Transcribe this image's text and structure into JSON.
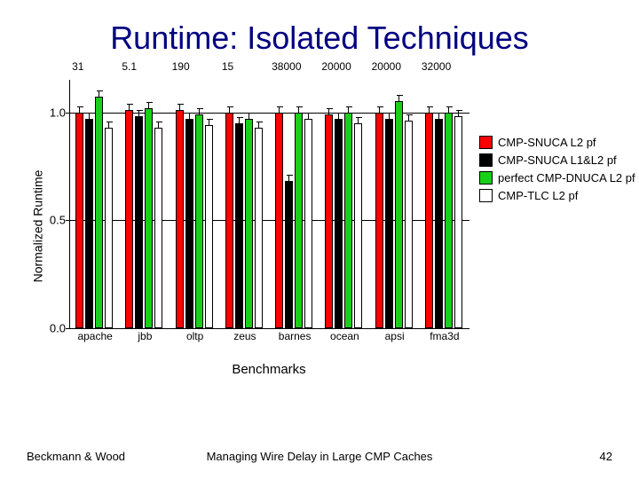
{
  "title": "Runtime: Isolated Techniques",
  "footer": {
    "left": "Beckmann & Wood",
    "center": "Managing Wire Delay in Large CMP Caches",
    "right": "42"
  },
  "chart_data": {
    "type": "bar",
    "title": "",
    "xlabel": "Benchmarks",
    "ylabel": "Normalized Runtime",
    "ylim": [
      0.0,
      1.15
    ],
    "yticks": [
      0.0,
      0.5,
      1.0
    ],
    "ytick_labels": [
      "0.0",
      "0.5",
      "1.0"
    ],
    "categories": [
      "apache",
      "jbb",
      "oltp",
      "zeus",
      "barnes",
      "ocean",
      "apsi",
      "fma3d"
    ],
    "upper_labels": [
      "31",
      "5.1",
      "190",
      "15",
      "38000",
      "20000",
      "20000",
      "32000"
    ],
    "series": [
      {
        "name": "CMP-SNUCA L2 pf",
        "color": "#ff0000",
        "values": [
          1.0,
          1.01,
          1.01,
          1.0,
          1.0,
          0.99,
          1.0,
          1.0
        ]
      },
      {
        "name": "CMP-SNUCA L1&L2 pf",
        "color": "#000000",
        "values": [
          0.97,
          0.98,
          0.97,
          0.95,
          0.68,
          0.97,
          0.97,
          0.97
        ]
      },
      {
        "name": "perfect CMP-DNUCA L2 pf",
        "color": "#18d018",
        "values": [
          1.07,
          1.02,
          0.99,
          0.97,
          1.0,
          1.0,
          1.05,
          1.0
        ]
      },
      {
        "name": "CMP-TLC L2 pf",
        "color": "#ffffff",
        "values": [
          0.93,
          0.93,
          0.94,
          0.93,
          0.97,
          0.95,
          0.96,
          0.98
        ]
      }
    ]
  }
}
